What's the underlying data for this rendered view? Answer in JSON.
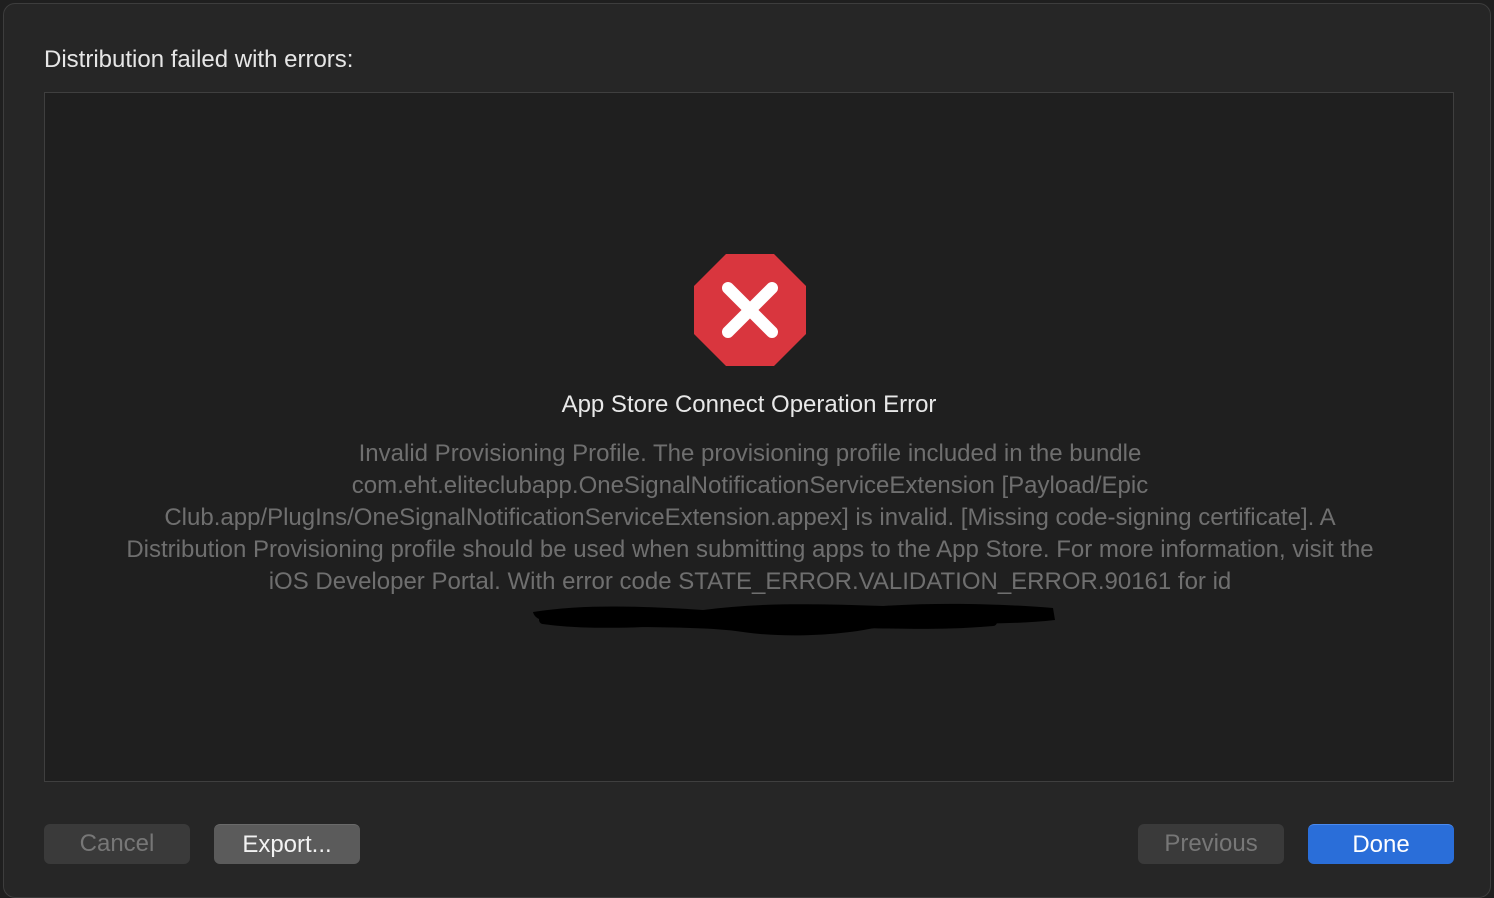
{
  "dialog": {
    "heading": "Distribution failed with errors:",
    "error": {
      "icon": "error-x-octagon-icon",
      "icon_color": "#d9363e",
      "title": "App Store Connect Operation Error",
      "message": "Invalid Provisioning Profile. The provisioning profile included in the bundle com.eht.eliteclubapp.OneSignalNotificationServiceExtension [Payload/Epic Club.app/PlugIns/OneSignalNotificationServiceExtension.appex] is invalid. [Missing code-signing certificate]. A Distribution Provisioning profile should be used when submitting apps to the App Store. For more information, visit the iOS Developer Portal. With error code STATE_ERROR.VALIDATION_ERROR.90161 for id"
    }
  },
  "buttons": {
    "cancel": "Cancel",
    "export": "Export...",
    "previous": "Previous",
    "done": "Done"
  },
  "colors": {
    "accent": "#2a6ed9",
    "background": "#262626"
  }
}
